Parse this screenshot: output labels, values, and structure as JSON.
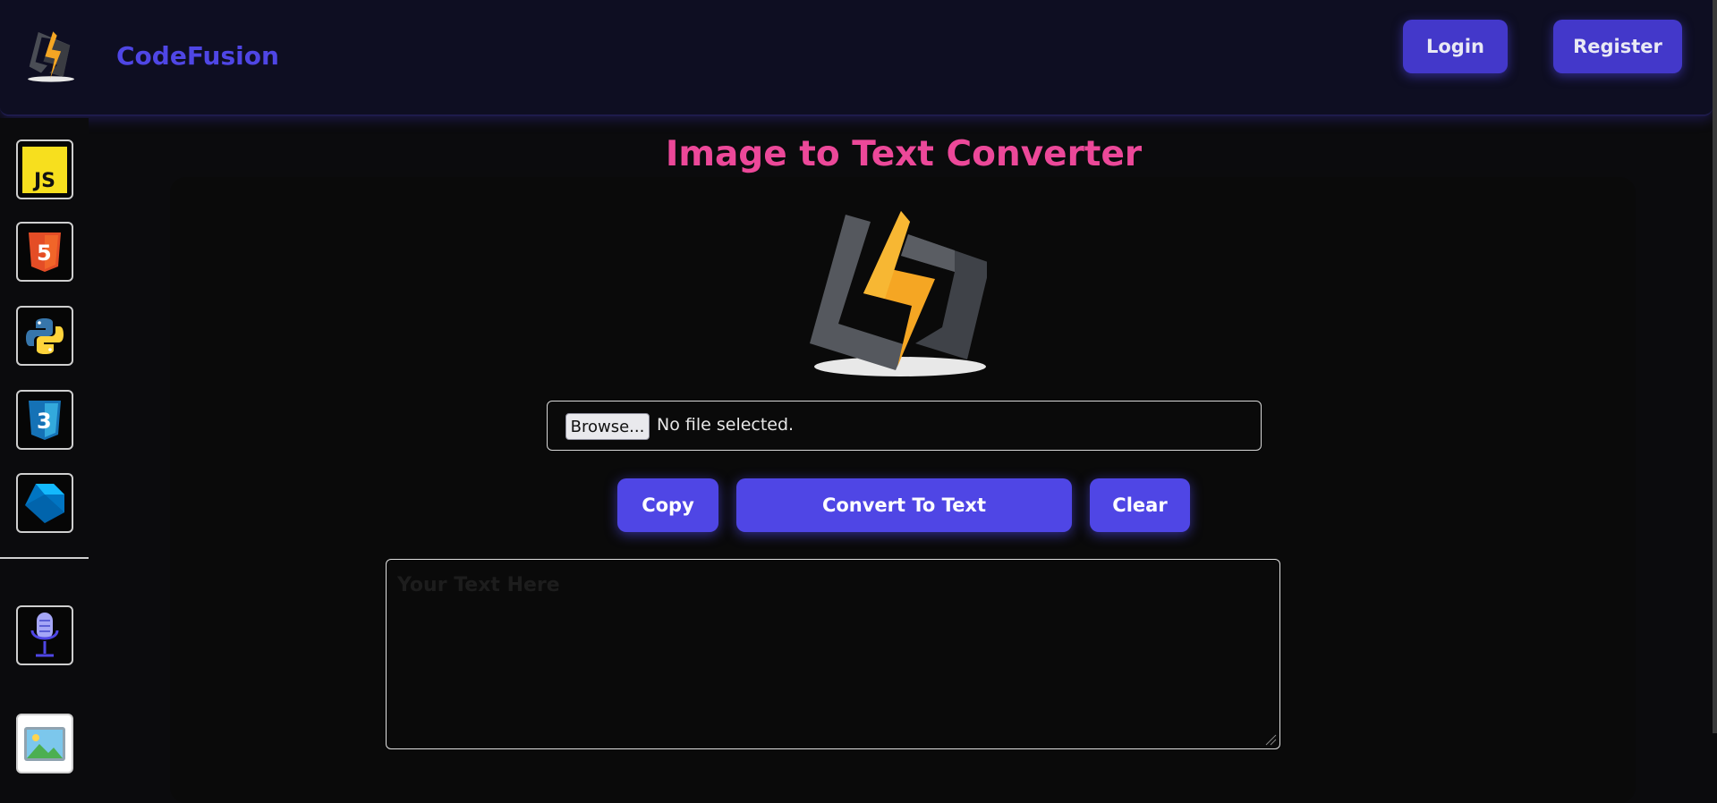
{
  "app": {
    "name": "CodeFusion"
  },
  "header": {
    "login_label": "Login",
    "register_label": "Register"
  },
  "sidebar": {
    "items": [
      {
        "icon": "javascript-icon",
        "label": "JS"
      },
      {
        "icon": "html5-icon",
        "label": "5"
      },
      {
        "icon": "python-icon"
      },
      {
        "icon": "css3-icon",
        "label": "3"
      },
      {
        "icon": "dart-icon"
      },
      {
        "icon": "microphone-icon"
      },
      {
        "icon": "image-icon"
      }
    ]
  },
  "main": {
    "title": "Image to Text Converter",
    "file_input": {
      "browse_label": "Browse...",
      "status": "No file selected."
    },
    "buttons": {
      "copy": "Copy",
      "convert": "Convert To Text",
      "clear": "Clear"
    },
    "textarea": {
      "placeholder": "Your Text Here",
      "value": ""
    }
  },
  "colors": {
    "accent": "#4f46e5",
    "title": "#ec4899",
    "header_bg": "#0e0e22"
  }
}
